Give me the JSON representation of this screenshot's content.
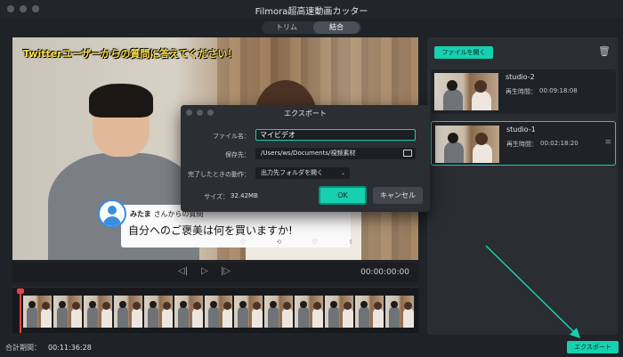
{
  "app": {
    "title": "Filmora超高速動画カッター"
  },
  "tabs": [
    {
      "label": "トリム"
    },
    {
      "label": "結合"
    }
  ],
  "video": {
    "banner": "Twitterユーザーからの質問に答えてください！",
    "card_name": "みたま",
    "card_sub": "さんからの質問",
    "card_question": "自分へのご褒美は何を買いますか!",
    "card_icons": "♡ ⟲ ♡ ⇪"
  },
  "controls": {
    "timecode": "00:00:00:00",
    "prev_icon": "prev-frame-icon",
    "play_icon": "play-icon",
    "next_icon": "next-frame-icon"
  },
  "timeline": {
    "frame_count": 13
  },
  "footer": {
    "total_label": "合計期間：",
    "total_value": "00:11:36:28",
    "export_label": "エクスポート"
  },
  "panel": {
    "open_label": "ファイルを開く",
    "clips": [
      {
        "name": "studio-2",
        "duration_label": "再生時間：",
        "duration": "00:09:18:08",
        "selected": false
      },
      {
        "name": "studio-1",
        "duration_label": "再生時間：",
        "duration": "00:02:18:20",
        "selected": true
      }
    ]
  },
  "dialog": {
    "title": "エクスポート",
    "filename_label": "ファイル名：",
    "filename_value": "マイビデオ",
    "path_label": "保存先：",
    "path_value": "/Users/ws/Documents/視频素材",
    "action_label": "完了したときの動作：",
    "action_value": "出力先フォルダを開く",
    "size_label": "サイズ：",
    "size_value": "32.42MB",
    "ok_label": "OK",
    "cancel_label": "キャンセル"
  },
  "colors": {
    "accent": "#17d0b0",
    "playhead": "#e64343",
    "background": "#1f2226"
  }
}
